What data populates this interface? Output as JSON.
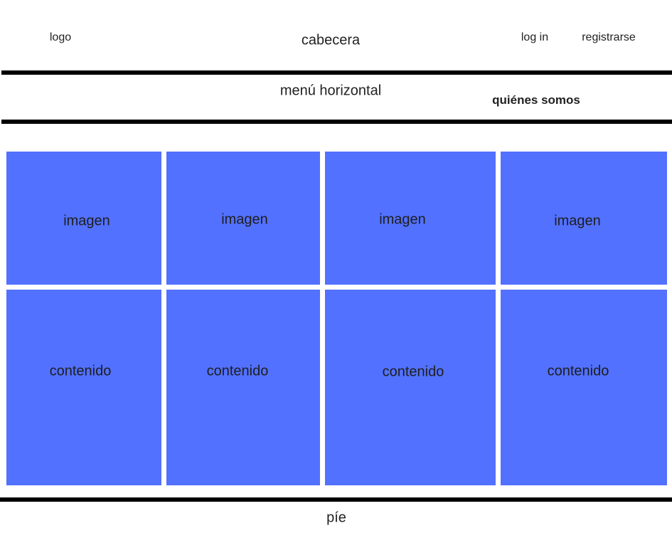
{
  "header": {
    "logo": "logo",
    "title": "cabecera",
    "login": "log in",
    "register": "registrarse"
  },
  "nav": {
    "label": "menú horizontal",
    "about": "quiénes somos"
  },
  "grid": {
    "image_label": "imagen",
    "content_label": "contenido"
  },
  "footer": {
    "label": "píe"
  },
  "colors": {
    "block": "#5271ff",
    "rule": "#000000"
  }
}
